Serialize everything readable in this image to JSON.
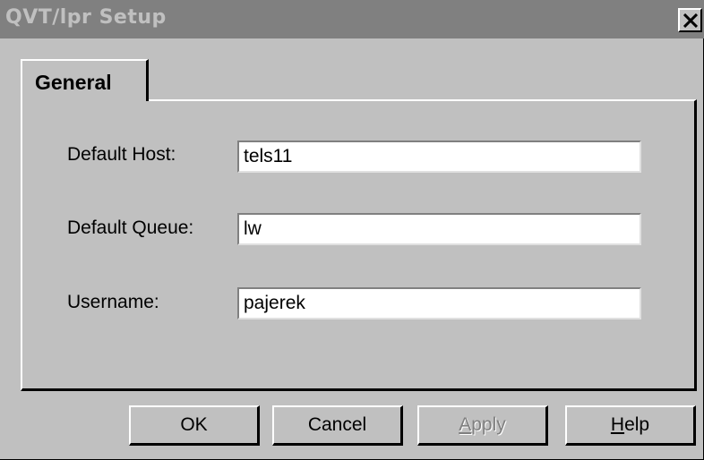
{
  "window": {
    "title": "QVT/lpr Setup",
    "close_symbol": "✕"
  },
  "tabs": [
    {
      "label": "General",
      "selected": true
    }
  ],
  "fields": {
    "default_host": {
      "label": "Default Host:",
      "value": "tels11"
    },
    "default_queue": {
      "label": "Default Queue:",
      "value": "lw"
    },
    "username": {
      "label": "Username:",
      "value": "pajerek"
    }
  },
  "buttons": {
    "ok": {
      "label": "OK"
    },
    "cancel": {
      "label": "Cancel"
    },
    "apply": {
      "label_first": "A",
      "label_rest": "pply",
      "disabled": true
    },
    "help": {
      "label_first": "H",
      "label_rest": "elp"
    }
  },
  "colors": {
    "face": "#c0c0c0",
    "titlebar_inactive": "#808080",
    "highlight": "#ffffff",
    "shadow": "#000000"
  }
}
